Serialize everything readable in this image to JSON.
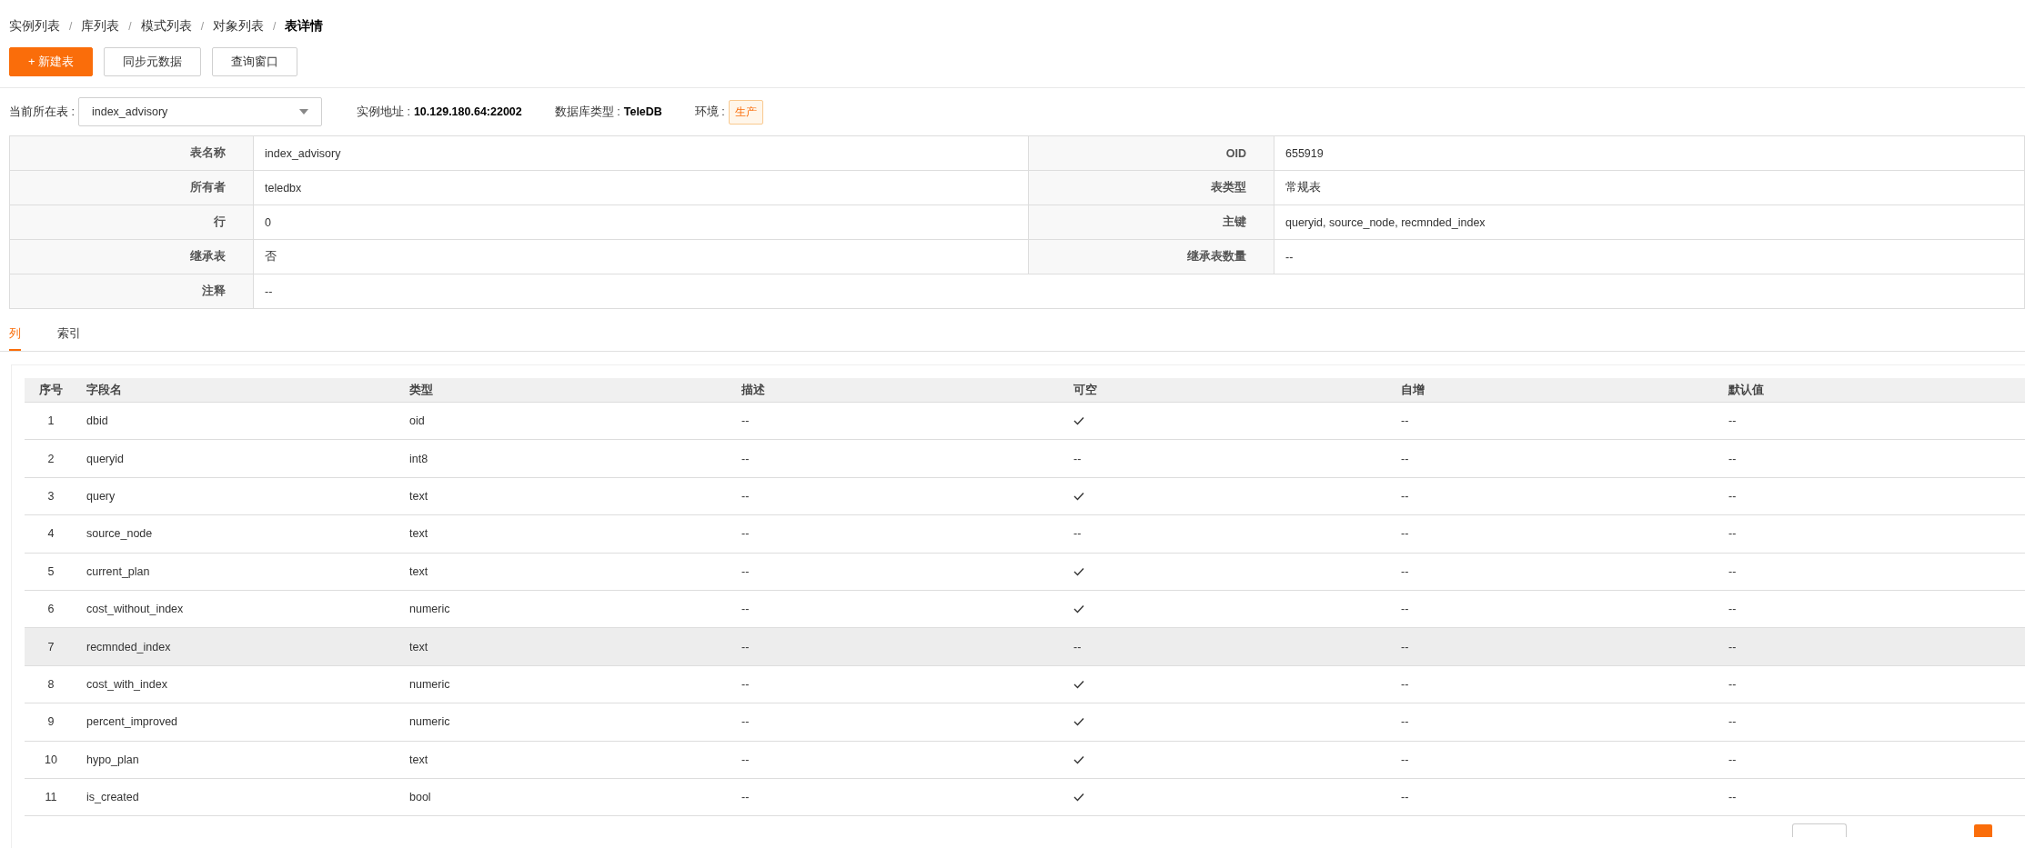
{
  "breadcrumb": [
    {
      "label": "实例列表",
      "current": false
    },
    {
      "label": "库列表",
      "current": false
    },
    {
      "label": "模式列表",
      "current": false
    },
    {
      "label": "对象列表",
      "current": false
    },
    {
      "label": "表详情",
      "current": true
    }
  ],
  "breadcrumb_separator": "/",
  "toolbar": [
    {
      "label": "+ 新建表",
      "primary": true
    },
    {
      "label": "同步元数据",
      "primary": false
    },
    {
      "label": "查询窗口",
      "primary": false
    }
  ],
  "context": {
    "table_label": "当前所在表 :",
    "table_value": "index_advisory",
    "address_label": "实例地址 :",
    "address": "10.129.180.64:22002",
    "db_type_label": "数据库类型 :",
    "db_type": "TeleDB",
    "env_label": "环境 :",
    "env": "生产"
  },
  "info": [
    [
      {
        "label": "表名称",
        "value": "index_advisory"
      },
      {
        "label": "OID",
        "value": "655919"
      }
    ],
    [
      {
        "label": "所有者",
        "value": "teledbx"
      },
      {
        "label": "表类型",
        "value": "常规表"
      }
    ],
    [
      {
        "label": "行",
        "value": "0"
      },
      {
        "label": "主键",
        "value": "queryid, source_node, recmnded_index"
      }
    ],
    [
      {
        "label": "继承表",
        "value": "否"
      },
      {
        "label": "继承表数量",
        "value": "--"
      }
    ],
    [
      {
        "label": "注释",
        "value": "--"
      }
    ]
  ],
  "tabs": [
    {
      "label": "列",
      "selected": true
    },
    {
      "label": "索引",
      "selected": false
    }
  ],
  "table": {
    "columns": [
      "序号",
      "字段名",
      "类型",
      "描述",
      "可空",
      "自增",
      "默认值"
    ],
    "rows": [
      {
        "no": "1",
        "name": "dbid",
        "type": "oid",
        "desc": "--",
        "nullable": true,
        "auto": "--",
        "default": "--",
        "hovered": false
      },
      {
        "no": "2",
        "name": "queryid",
        "type": "int8",
        "desc": "--",
        "nullable": false,
        "nullable_text": "--",
        "auto": "--",
        "default": "--",
        "hovered": false
      },
      {
        "no": "3",
        "name": "query",
        "type": "text",
        "desc": "--",
        "nullable": true,
        "auto": "--",
        "default": "--",
        "hovered": false
      },
      {
        "no": "4",
        "name": "source_node",
        "type": "text",
        "desc": "--",
        "nullable": false,
        "nullable_text": "--",
        "auto": "--",
        "default": "--",
        "hovered": false
      },
      {
        "no": "5",
        "name": "current_plan",
        "type": "text",
        "desc": "--",
        "nullable": true,
        "auto": "--",
        "default": "--",
        "hovered": false
      },
      {
        "no": "6",
        "name": "cost_without_index",
        "type": "numeric",
        "desc": "--",
        "nullable": true,
        "auto": "--",
        "default": "--",
        "hovered": false
      },
      {
        "no": "7",
        "name": "recmnded_index",
        "type": "text",
        "desc": "--",
        "nullable": false,
        "nullable_text": "--",
        "auto": "--",
        "default": "--",
        "hovered": true
      },
      {
        "no": "8",
        "name": "cost_with_index",
        "type": "numeric",
        "desc": "--",
        "nullable": true,
        "auto": "--",
        "default": "--",
        "hovered": false
      },
      {
        "no": "9",
        "name": "percent_improved",
        "type": "numeric",
        "desc": "--",
        "nullable": true,
        "auto": "--",
        "default": "--",
        "hovered": false
      },
      {
        "no": "10",
        "name": "hypo_plan",
        "type": "text",
        "desc": "--",
        "nullable": true,
        "auto": "--",
        "default": "--",
        "hovered": false
      },
      {
        "no": "11",
        "name": "is_created",
        "type": "bool",
        "desc": "--",
        "nullable": true,
        "auto": "--",
        "default": "--",
        "hovered": false
      }
    ]
  }
}
